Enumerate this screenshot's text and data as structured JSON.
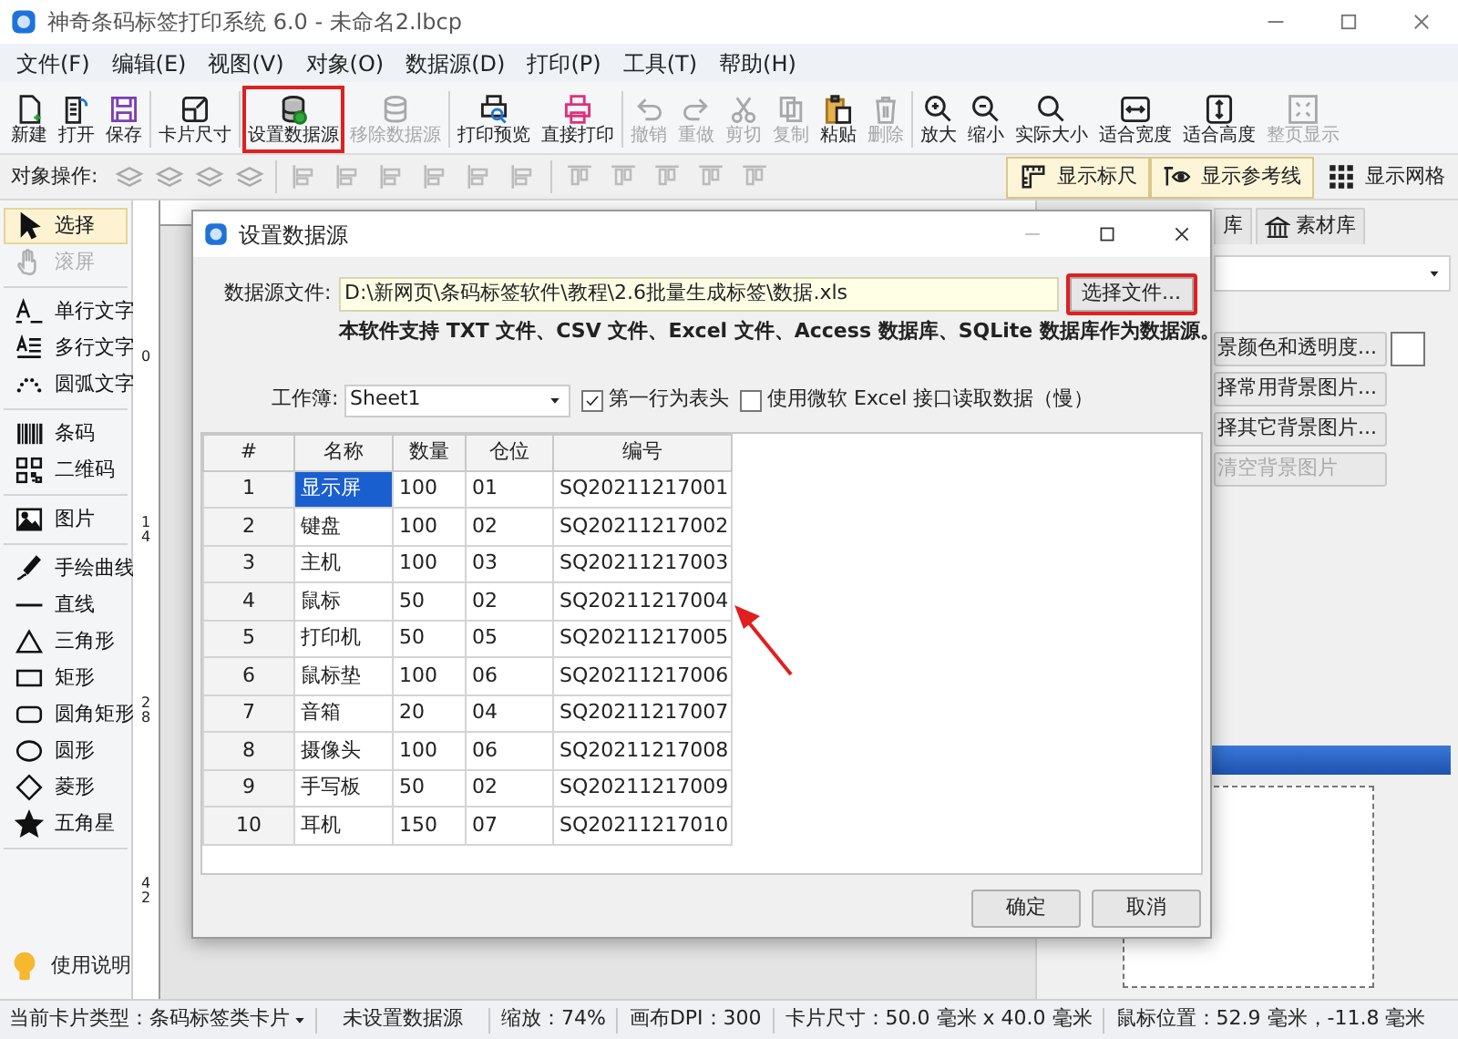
{
  "window": {
    "title": "神奇条码标签打印系统 6.0 - 未命名2.lbcp"
  },
  "menu": [
    "文件(F)",
    "编辑(E)",
    "视图(V)",
    "对象(O)",
    "数据源(D)",
    "打印(P)",
    "工具(T)",
    "帮助(H)"
  ],
  "toolbar_groups": [
    [
      {
        "label": "新建",
        "disabled": false,
        "highlighted": false
      },
      {
        "label": "打开",
        "disabled": false,
        "highlighted": false
      },
      {
        "label": "保存",
        "disabled": false,
        "highlighted": false
      }
    ],
    [
      {
        "label": "卡片尺寸",
        "disabled": false,
        "highlighted": false
      }
    ],
    [
      {
        "label": "设置数据源",
        "disabled": false,
        "highlighted": true
      },
      {
        "label": "移除数据源",
        "disabled": true,
        "highlighted": false
      }
    ],
    [
      {
        "label": "打印预览",
        "disabled": false,
        "highlighted": false
      },
      {
        "label": "直接打印",
        "disabled": false,
        "highlighted": false
      }
    ],
    [
      {
        "label": "撤销",
        "disabled": true,
        "highlighted": false
      },
      {
        "label": "重做",
        "disabled": true,
        "highlighted": false
      },
      {
        "label": "剪切",
        "disabled": true,
        "highlighted": false
      },
      {
        "label": "复制",
        "disabled": true,
        "highlighted": false
      },
      {
        "label": "粘贴",
        "disabled": false,
        "highlighted": false
      },
      {
        "label": "删除",
        "disabled": true,
        "highlighted": false
      }
    ],
    [
      {
        "label": "放大",
        "disabled": false,
        "highlighted": false
      },
      {
        "label": "缩小",
        "disabled": false,
        "highlighted": false
      },
      {
        "label": "实际大小",
        "disabled": false,
        "highlighted": false
      },
      {
        "label": "适合宽度",
        "disabled": false,
        "highlighted": false
      },
      {
        "label": "适合高度",
        "disabled": false,
        "highlighted": false
      },
      {
        "label": "整页显示",
        "disabled": true,
        "highlighted": false
      }
    ]
  ],
  "object_toolbar": {
    "label": "对象操作:",
    "toggles": [
      {
        "label": "显示标尺",
        "on": true
      },
      {
        "label": "显示参考线",
        "on": true
      },
      {
        "label": "显示网格",
        "on": false
      }
    ]
  },
  "tool_groups": [
    [
      {
        "label": "选择",
        "selected": true,
        "disabled": false
      },
      {
        "label": "滚屏",
        "selected": false,
        "disabled": true
      }
    ],
    [
      {
        "label": "单行文字",
        "selected": false,
        "disabled": false
      },
      {
        "label": "多行文字",
        "selected": false,
        "disabled": false
      },
      {
        "label": "圆弧文字",
        "selected": false,
        "disabled": false
      }
    ],
    [
      {
        "label": "条码",
        "selected": false,
        "disabled": false
      },
      {
        "label": "二维码",
        "selected": false,
        "disabled": false
      }
    ],
    [
      {
        "label": "图片",
        "selected": false,
        "disabled": false
      }
    ],
    [
      {
        "label": "手绘曲线",
        "selected": false,
        "disabled": false
      },
      {
        "label": "直线",
        "selected": false,
        "disabled": false
      },
      {
        "label": "三角形",
        "selected": false,
        "disabled": false
      },
      {
        "label": "矩形",
        "selected": false,
        "disabled": false
      },
      {
        "label": "圆角矩形",
        "selected": false,
        "disabled": false
      },
      {
        "label": "圆形",
        "selected": false,
        "disabled": false
      },
      {
        "label": "菱形",
        "selected": false,
        "disabled": false
      },
      {
        "label": "五角星",
        "selected": false,
        "disabled": false
      }
    ]
  ],
  "help": {
    "label": "使用说明"
  },
  "ruler": {
    "labels": [
      "0",
      "14",
      "28",
      "42"
    ]
  },
  "right_panel": {
    "tabs": [
      {
        "label": "库",
        "selected": false
      },
      {
        "label": "素材库",
        "selected": false
      }
    ],
    "buttons": [
      {
        "label": "景颜色和透明度...",
        "disabled": false
      },
      {
        "label": "择常用背景图片...",
        "disabled": false
      },
      {
        "label": "择其它背景图片...",
        "disabled": false
      },
      {
        "label": "清空背景图片",
        "disabled": true
      }
    ]
  },
  "dialog": {
    "title": "设置数据源",
    "file_label": "数据源文件:",
    "file_path": "D:\\新网页\\条码标签软件\\教程\\2.6批量生成标签\\数据.xls",
    "choose_button": {
      "label": "选择文件...",
      "highlighted": true
    },
    "info": "本软件支持 TXT 文件、CSV 文件、Excel 文件、Access 数据库、SQLite 数据库作为数据源。",
    "workbook_label": "工作簿:",
    "workbook": "Sheet1",
    "options": [
      {
        "label": "第一行为表头",
        "checked": true
      },
      {
        "label": "使用微软 Excel 接口读取数据（慢）",
        "checked": false
      }
    ],
    "table": {
      "columns": [
        "#",
        "名称",
        "数量",
        "仓位",
        "编号"
      ],
      "rows": [
        {
          "cells": [
            {
              "text": "1",
              "selected": false
            },
            {
              "text": "显示屏",
              "selected": true
            },
            {
              "text": "100",
              "selected": false
            },
            {
              "text": "01",
              "selected": false
            },
            {
              "text": "SQ20211217001",
              "selected": false
            }
          ]
        },
        {
          "cells": [
            {
              "text": "2",
              "selected": false
            },
            {
              "text": "键盘",
              "selected": false
            },
            {
              "text": "100",
              "selected": false
            },
            {
              "text": "02",
              "selected": false
            },
            {
              "text": "SQ20211217002",
              "selected": false
            }
          ]
        },
        {
          "cells": [
            {
              "text": "3",
              "selected": false
            },
            {
              "text": "主机",
              "selected": false
            },
            {
              "text": "100",
              "selected": false
            },
            {
              "text": "03",
              "selected": false
            },
            {
              "text": "SQ20211217003",
              "selected": false
            }
          ]
        },
        {
          "cells": [
            {
              "text": "4",
              "selected": false
            },
            {
              "text": "鼠标",
              "selected": false
            },
            {
              "text": "50",
              "selected": false
            },
            {
              "text": "02",
              "selected": false
            },
            {
              "text": "SQ20211217004",
              "selected": false
            }
          ]
        },
        {
          "cells": [
            {
              "text": "5",
              "selected": false
            },
            {
              "text": "打印机",
              "selected": false
            },
            {
              "text": "50",
              "selected": false
            },
            {
              "text": "05",
              "selected": false
            },
            {
              "text": "SQ20211217005",
              "selected": false
            }
          ]
        },
        {
          "cells": [
            {
              "text": "6",
              "selected": false
            },
            {
              "text": "鼠标垫",
              "selected": false
            },
            {
              "text": "100",
              "selected": false
            },
            {
              "text": "06",
              "selected": false
            },
            {
              "text": "SQ20211217006",
              "selected": false
            }
          ]
        },
        {
          "cells": [
            {
              "text": "7",
              "selected": false
            },
            {
              "text": "音箱",
              "selected": false
            },
            {
              "text": "20",
              "selected": false
            },
            {
              "text": "04",
              "selected": false
            },
            {
              "text": "SQ20211217007",
              "selected": false
            }
          ]
        },
        {
          "cells": [
            {
              "text": "8",
              "selected": false
            },
            {
              "text": "摄像头",
              "selected": false
            },
            {
              "text": "100",
              "selected": false
            },
            {
              "text": "06",
              "selected": false
            },
            {
              "text": "SQ20211217008",
              "selected": false
            }
          ]
        },
        {
          "cells": [
            {
              "text": "9",
              "selected": false
            },
            {
              "text": "手写板",
              "selected": false
            },
            {
              "text": "50",
              "selected": false
            },
            {
              "text": "02",
              "selected": false
            },
            {
              "text": "SQ20211217009",
              "selected": false
            }
          ]
        },
        {
          "cells": [
            {
              "text": "10",
              "selected": false
            },
            {
              "text": "耳机",
              "selected": false
            },
            {
              "text": "150",
              "selected": false
            },
            {
              "text": "07",
              "selected": false
            },
            {
              "text": "SQ20211217010",
              "selected": false
            }
          ]
        }
      ]
    },
    "buttons": [
      "确定",
      "取消"
    ]
  },
  "status_bar": [
    {
      "kind": "dropdown",
      "text": "当前卡片类型：条码标签类卡片"
    },
    {
      "kind": "text",
      "text": "未设置数据源"
    },
    {
      "kind": "text",
      "text": "缩放：74%"
    },
    {
      "kind": "text",
      "text": "画布DPI：300"
    },
    {
      "kind": "text",
      "text": "卡片尺寸：50.0 毫米 x 40.0 毫米"
    },
    {
      "kind": "text",
      "text": "鼠标位置：52.9 毫米，-11.8 毫米"
    }
  ]
}
